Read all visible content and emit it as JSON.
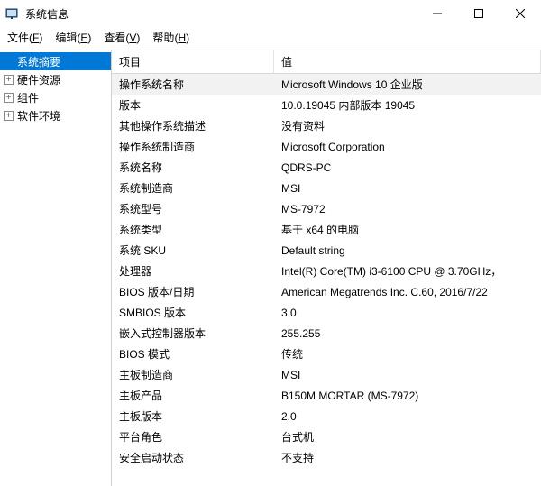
{
  "window": {
    "title": "系统信息"
  },
  "menu": {
    "file": {
      "label": "文件",
      "key": "F"
    },
    "edit": {
      "label": "编辑",
      "key": "E"
    },
    "view": {
      "label": "查看",
      "key": "V"
    },
    "help": {
      "label": "帮助",
      "key": "H"
    }
  },
  "tree": {
    "root_label": "系统摘要",
    "children": [
      {
        "label": "硬件资源",
        "expandable": true
      },
      {
        "label": "组件",
        "expandable": true
      },
      {
        "label": "软件环境",
        "expandable": true
      }
    ]
  },
  "table": {
    "headers": {
      "item": "项目",
      "value": "值"
    },
    "rows": [
      {
        "item": "操作系统名称",
        "value": "Microsoft Windows 10 企业版",
        "alt": true
      },
      {
        "item": "版本",
        "value": "10.0.19045 内部版本 19045"
      },
      {
        "item": "其他操作系统描述",
        "value": "没有资料"
      },
      {
        "item": "操作系统制造商",
        "value": "Microsoft Corporation"
      },
      {
        "item": "系统名称",
        "value": "QDRS-PC"
      },
      {
        "item": "系统制造商",
        "value": "MSI"
      },
      {
        "item": "系统型号",
        "value": "MS-7972"
      },
      {
        "item": "系统类型",
        "value": "基于 x64 的电脑"
      },
      {
        "item": "系统 SKU",
        "value": "Default string"
      },
      {
        "item": "处理器",
        "value": "Intel(R) Core(TM) i3-6100 CPU @ 3.70GHz，"
      },
      {
        "item": "BIOS 版本/日期",
        "value": "American Megatrends Inc. C.60, 2016/7/22"
      },
      {
        "item": "SMBIOS 版本",
        "value": "3.0"
      },
      {
        "item": "嵌入式控制器版本",
        "value": "255.255"
      },
      {
        "item": "BIOS 模式",
        "value": "传统"
      },
      {
        "item": "主板制造商",
        "value": "MSI"
      },
      {
        "item": "主板产品",
        "value": "B150M MORTAR (MS-7972)"
      },
      {
        "item": "主板版本",
        "value": "2.0"
      },
      {
        "item": "平台角色",
        "value": "台式机"
      },
      {
        "item": "安全启动状态",
        "value": "不支持"
      }
    ]
  }
}
